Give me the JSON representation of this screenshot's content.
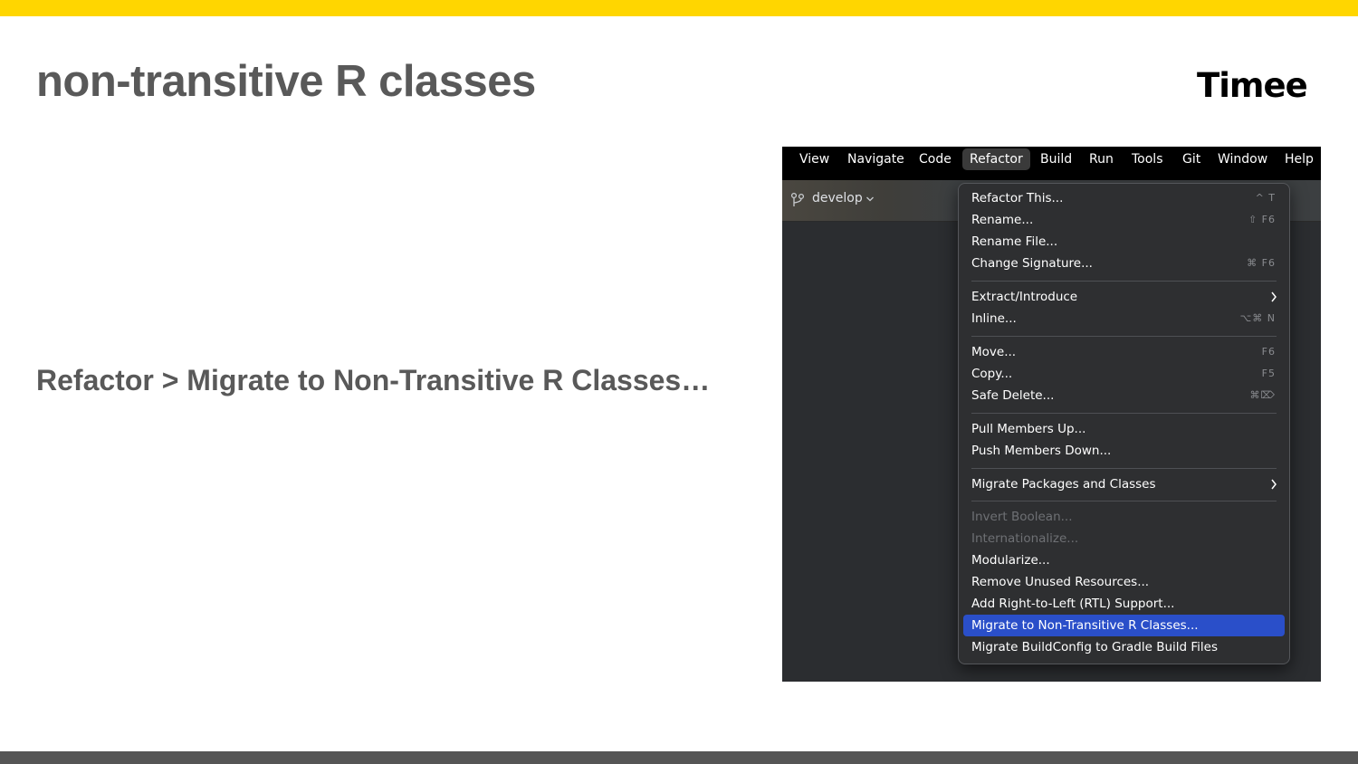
{
  "slide": {
    "title": "non-transitive R classes",
    "logo": "Timee",
    "body": "Refactor > Migrate to Non-Transitive R Classes…",
    "accent_color": "#ffd600"
  },
  "ide": {
    "menubar": [
      "View",
      "Navigate",
      "Code",
      "Refactor",
      "Build",
      "Run",
      "Tools",
      "Git",
      "Window",
      "Help"
    ],
    "active_menu": "Refactor",
    "branch": "develop",
    "menu_items": [
      {
        "label": "Refactor This...",
        "shortcut": "^ T"
      },
      {
        "label": "Rename...",
        "shortcut": "⇧ F6"
      },
      {
        "label": "Rename File...",
        "shortcut": ""
      },
      {
        "label": "Change Signature...",
        "shortcut": "⌘ F6"
      },
      {
        "label": "Extract/Introduce",
        "shortcut": "",
        "submenu": true
      },
      {
        "label": "Inline...",
        "shortcut": "⌥⌘ N"
      },
      {
        "label": "Move...",
        "shortcut": "F6"
      },
      {
        "label": "Copy...",
        "shortcut": "F5"
      },
      {
        "label": "Safe Delete...",
        "shortcut": "⌘⌦"
      },
      {
        "label": "Pull Members Up...",
        "shortcut": ""
      },
      {
        "label": "Push Members Down...",
        "shortcut": ""
      },
      {
        "label": "Migrate Packages and Classes",
        "shortcut": "",
        "submenu": true
      },
      {
        "label": "Invert Boolean...",
        "shortcut": "",
        "disabled": true
      },
      {
        "label": "Internationalize...",
        "shortcut": "",
        "disabled": true
      },
      {
        "label": "Modularize...",
        "shortcut": ""
      },
      {
        "label": "Remove Unused Resources...",
        "shortcut": ""
      },
      {
        "label": "Add Right-to-Left (RTL) Support...",
        "shortcut": ""
      },
      {
        "label": "Migrate to Non-Transitive R Classes...",
        "shortcut": "",
        "selected": true
      },
      {
        "label": "Migrate BuildConfig to Gradle Build Files",
        "shortcut": ""
      }
    ],
    "selection_color": "#2a4fc9"
  }
}
